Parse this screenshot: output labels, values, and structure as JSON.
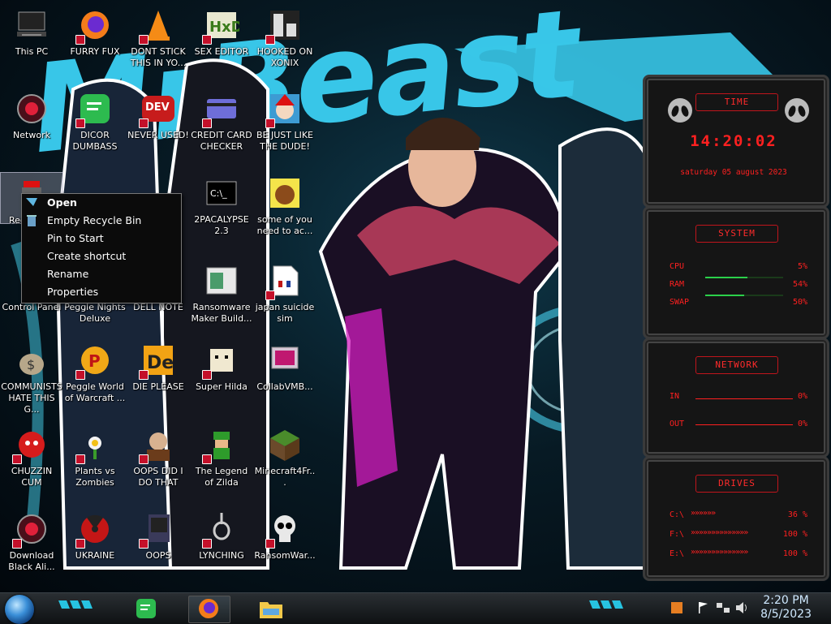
{
  "desktop_icons": [
    {
      "label": "This PC"
    },
    {
      "label": "FURRY FUX"
    },
    {
      "label": "DONT STICK THIS IN YO..."
    },
    {
      "label": "SEX EDITOR"
    },
    {
      "label": "HOOKED ON XONIX"
    },
    {
      "label": "Network"
    },
    {
      "label": "DICOR DUMBASS"
    },
    {
      "label": "NEVER USED!"
    },
    {
      "label": "CREDIT CARD CHECKER"
    },
    {
      "label": "BE JUST LIKE THE DUDE!"
    },
    {
      "label": "Rec"
    },
    {
      "label": "2PACALYPSE 2.3"
    },
    {
      "label": "some of you need to ac..."
    },
    {
      "label": "Control Panel"
    },
    {
      "label": "Peggle Nights Deluxe"
    },
    {
      "label": "DELL NOTE"
    },
    {
      "label": "Ransomware Maker Build..."
    },
    {
      "label": "japan suicide sim"
    },
    {
      "label": "COMMUNISTS HATE THIS G..."
    },
    {
      "label": "Peggle World of Warcraft ..."
    },
    {
      "label": "DIE PLEASE"
    },
    {
      "label": "Super Hilda"
    },
    {
      "label": "CollabVMB..."
    },
    {
      "label": "CHUZZIN CUM"
    },
    {
      "label": "Plants vs Zombies"
    },
    {
      "label": "OOPS DID I DO THAT"
    },
    {
      "label": "The Legend of Zilda"
    },
    {
      "label": "Minecraft4Fr..."
    },
    {
      "label": "Download Black Ali..."
    },
    {
      "label": "UKRAINE"
    },
    {
      "label": "OOPS"
    },
    {
      "label": "LYNCHING"
    },
    {
      "label": "RansomWar..."
    }
  ],
  "context_menu": {
    "open": "Open",
    "empty_recycle_bin": "Empty Recycle Bin",
    "pin_to_start": "Pin to Start",
    "create_shortcut": "Create shortcut",
    "rename": "Rename",
    "properties": "Properties"
  },
  "wallpaper": {
    "title": "MrBeast"
  },
  "gadgets": {
    "time": {
      "title": "TIME",
      "clock": "14:20:02",
      "date": "saturday 05 august 2023"
    },
    "system": {
      "title": "SYSTEM",
      "cpu_label": "CPU",
      "cpu_value": "5%",
      "ram_label": "RAM",
      "ram_value": "54%",
      "swap_label": "SWAP",
      "swap_value": "50%",
      "ram_fill": 0.54,
      "swap_fill": 0.5,
      "cpu_fill": 0.05
    },
    "network": {
      "title": "NETWORK",
      "in_label": "IN",
      "in_value": "0%",
      "out_label": "OUT",
      "out_value": "0%"
    },
    "drives": {
      "title": "DRIVES",
      "c_label": "C:\\",
      "c_value": "36 %",
      "f_label": "F:\\",
      "f_value": "100 %",
      "e_label": "E:\\",
      "e_value": "100 %"
    }
  },
  "taskbar": {
    "clock_time": "2:20 PM",
    "clock_date": "8/5/2023"
  },
  "colors": {
    "accent_red": "#ff2020",
    "wallpaper_cyan": "#38c6e8",
    "taskbar_cyan": "#27c3e0"
  }
}
